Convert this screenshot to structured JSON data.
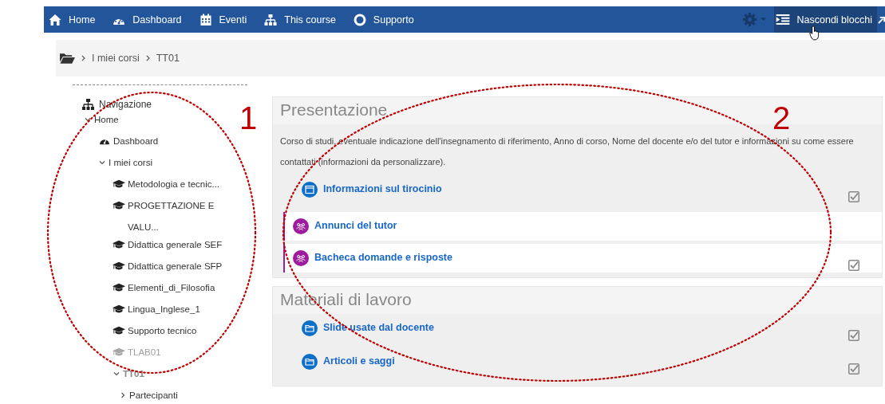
{
  "navbar": {
    "items": [
      {
        "kind": "home",
        "label": "Home"
      },
      {
        "kind": "dashboard",
        "label": "Dashboard"
      },
      {
        "kind": "calendar",
        "label": "Eventi"
      },
      {
        "kind": "sitemap",
        "label": "This course"
      },
      {
        "kind": "support",
        "label": "Supporto"
      }
    ],
    "hide_blocks": {
      "label": "Nascondi blocchi"
    }
  },
  "breadcrumb": [
    "I miei corsi",
    "TT01"
  ],
  "navigation": {
    "title": "Navigazione",
    "tree": [
      {
        "label": "Home",
        "kind": "branch",
        "expanded": true,
        "children": [
          {
            "label": "Dashboard",
            "kind": "dashboard"
          },
          {
            "label": "I miei corsi",
            "kind": "branch",
            "expanded": true,
            "children": [
              {
                "label": "Metodologia e tecnic...",
                "kind": "course",
                "dimmed": false
              },
              {
                "label": "PROGETTAZIONE E VALU...",
                "kind": "course",
                "dimmed": false
              },
              {
                "label": "Didattica generale SEF",
                "kind": "course",
                "dimmed": false
              },
              {
                "label": "Didattica generale SFP",
                "kind": "course",
                "dimmed": false
              },
              {
                "label": "Elementi_di_Filosofia",
                "kind": "course",
                "dimmed": false
              },
              {
                "label": "Lingua_Inglese_1",
                "kind": "course",
                "dimmed": false
              },
              {
                "label": "Supporto tecnico",
                "kind": "course",
                "dimmed": false
              },
              {
                "label": "TLAB01",
                "kind": "course",
                "dimmed": true
              },
              {
                "label": "TT01",
                "kind": "branch",
                "expanded": true,
                "children": [
                  {
                    "label": "Partecipanti",
                    "kind": "branch",
                    "expanded": false
                  }
                ]
              }
            ]
          }
        ]
      }
    ]
  },
  "sections": [
    {
      "title": "Presentazione",
      "summary": "Corso di studi, eventuale indicazione dell'insegnamento di riferimento, Anno di corso, Nome del docente e/o del tutor e informazioni su come essere contattati (informazioni da personalizzare).",
      "activities": [
        {
          "kind": "page",
          "name": "Informazioni sul tirocinio",
          "highlighted": false,
          "checked": true
        },
        {
          "kind": "forum",
          "name": "Annunci del tutor",
          "highlighted": true,
          "checked": false
        },
        {
          "kind": "forum",
          "name": "Bacheca domande e risposte",
          "highlighted": true,
          "checked": true
        }
      ]
    },
    {
      "title": "Materiali di lavoro",
      "activities": [
        {
          "kind": "folder",
          "name": "Slide usate dal docente",
          "highlighted": false,
          "checked": true
        },
        {
          "kind": "folder",
          "name": "Articoli e saggi",
          "highlighted": false,
          "checked": true
        }
      ]
    }
  ],
  "annotations": [
    {
      "label": "1"
    },
    {
      "label": "2"
    }
  ]
}
